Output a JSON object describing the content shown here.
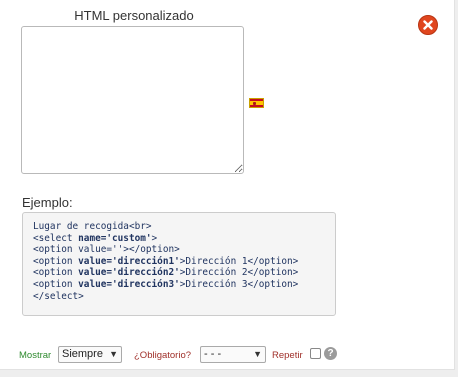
{
  "editor": {
    "title": "HTML personalizado",
    "textarea_value": ""
  },
  "language_flag": {
    "icon": "spain-flag-icon"
  },
  "close_button": {
    "icon": "close-icon",
    "color": "#e0461f"
  },
  "example": {
    "label": "Ejemplo:",
    "code_lines": [
      [
        {
          "t": "Lugar de recogida<br>",
          "b": false
        }
      ],
      [
        {
          "t": "<select ",
          "b": false
        },
        {
          "t": "name='custom'",
          "b": true
        },
        {
          "t": ">",
          "b": false
        }
      ],
      [
        {
          "t": "<option value=''></option>",
          "b": false
        }
      ],
      [
        {
          "t": "<option ",
          "b": false
        },
        {
          "t": "value='dirección1'",
          "b": true
        },
        {
          "t": ">Dirección 1</option>",
          "b": false
        }
      ],
      [
        {
          "t": "<option ",
          "b": false
        },
        {
          "t": "value='dirección2'",
          "b": true
        },
        {
          "t": ">Dirección 2</option>",
          "b": false
        }
      ],
      [
        {
          "t": "<option ",
          "b": false
        },
        {
          "t": "value='dirección3'",
          "b": true
        },
        {
          "t": ">Dirección 3</option>",
          "b": false
        }
      ],
      [
        {
          "t": "</select>",
          "b": false
        }
      ]
    ]
  },
  "footer": {
    "show_label": "Mostrar",
    "show_value": "Siempre",
    "required_label": "¿Obligatorio?",
    "required_value": "- - -",
    "repeat_label": "Repetir",
    "repeat_checked": false,
    "help_icon": "question-icon",
    "help_glyph": "?"
  },
  "colors": {
    "show_label": "#2e8a2e",
    "required_label": "#a0302a",
    "code_text": "#203460"
  }
}
